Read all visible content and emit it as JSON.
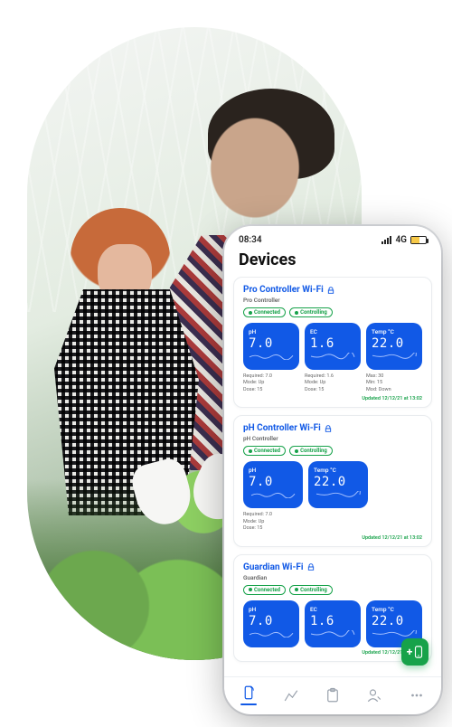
{
  "statusbar": {
    "time": "08:34",
    "network": "4G"
  },
  "page_title": "Devices",
  "cards": [
    {
      "title": "Pro Controller Wi-Fi",
      "subtitle": "Pro Controller",
      "status_connected": "Connected",
      "status_controlling": "Controlling",
      "tiles": [
        {
          "label": "pH",
          "value": "7.0"
        },
        {
          "label": "EC",
          "value": "1.6"
        },
        {
          "label": "Temp °C",
          "value": "22.0"
        }
      ],
      "meta": [
        {
          "l1": "Required: 7.0",
          "l2": "Mode: Up",
          "l3": "Dose: 15"
        },
        {
          "l1": "Required: 1.6",
          "l2": "Mode: Up",
          "l3": "Dose: 15"
        },
        {
          "l1": "Max: 30",
          "l2": "Min: 15",
          "l3": "Mod: Down"
        }
      ],
      "updated": "Updated 12/12/21 at 13:02"
    },
    {
      "title": "pH Controller Wi-Fi",
      "subtitle": "pH Controller",
      "status_connected": "Connected",
      "status_controlling": "Controlling",
      "tiles": [
        {
          "label": "pH",
          "value": "7.0"
        },
        {
          "label": "Temp °C",
          "value": "22.0"
        }
      ],
      "meta": [
        {
          "l1": "Required: 7.0",
          "l2": "Mode: Up",
          "l3": "Dose: 15"
        }
      ],
      "updated": "Updated 12/12/21 at 13:02"
    },
    {
      "title": "Guardian Wi-Fi",
      "subtitle": "Guardian",
      "status_connected": "Connected",
      "status_controlling": "Controlling",
      "tiles": [
        {
          "label": "pH",
          "value": "7.0"
        },
        {
          "label": "EC",
          "value": "1.6"
        },
        {
          "label": "Temp °C",
          "value": "22.0"
        }
      ],
      "meta": [],
      "updated": "Updated 12/12/21 at 13:02"
    }
  ],
  "fab_label": "+"
}
